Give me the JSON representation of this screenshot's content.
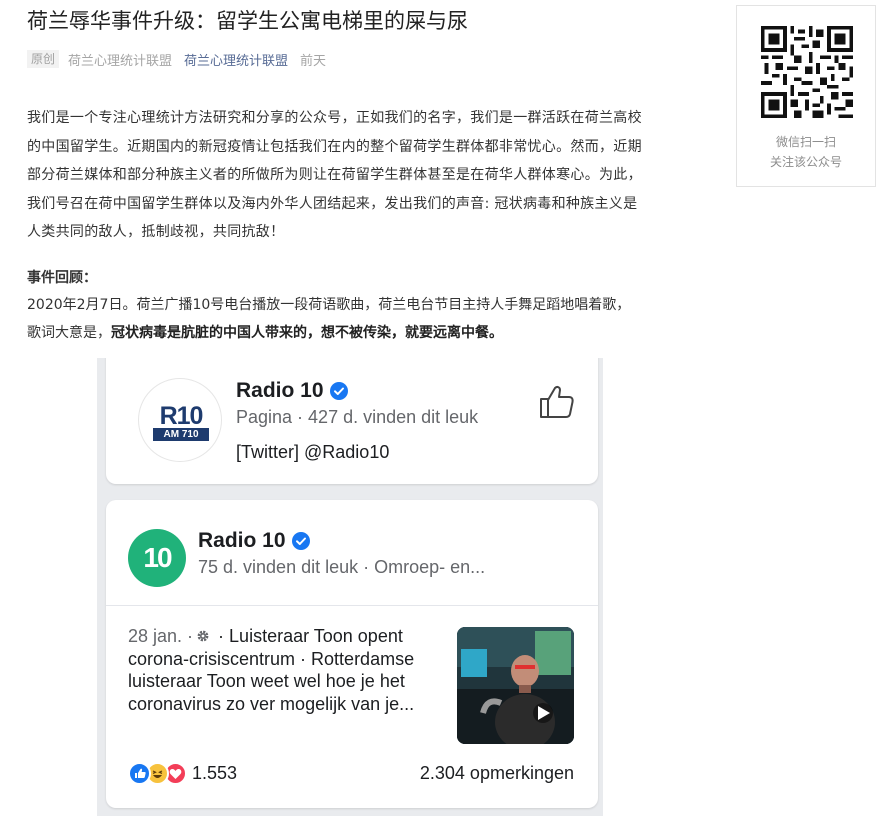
{
  "article": {
    "title": "荷兰辱华事件升级：留学生公寓电梯里的屎与尿",
    "meta": {
      "badge": "原创",
      "author": "荷兰心理统计联盟",
      "account": "荷兰心理统计联盟",
      "date": "前天"
    },
    "intro_lines": [
      "我们是一个专注心理统计方法研究和分享的公众号，正如我们的名字，我们是一群活跃在荷兰高校",
      "的中国留学生。近期国内的新冠疫情让包括我们在内的整个留荷学生群体都非常忧心。然而，近期",
      "部分荷兰媒体和部分种族主义者的所做所为则让在荷留学生群体甚至是在荷华人群体寒心。为此，",
      "我们号召在荷中国留学生群体以及海内外华人团结起来，发出我们的声音: 冠状病毒和种族主义是",
      "人类共同的敌人，抵制歧视，共同抗敌！"
    ],
    "recap_title": "事件回顾：",
    "recap_line1": "2020年2月7日。荷兰广播10号电台播放一段荷语歌曲，荷兰电台节目主持人手舞足蹈地唱着歌，",
    "recap_line2_prefix": "歌词大意是，",
    "recap_line2_bold": "冠状病毒是肮脏的中国人带来的，想不被传染，就要远离中餐。"
  },
  "qr": {
    "caption_line1": "微信扫一扫",
    "caption_line2": "关注该公众号"
  },
  "screenshot": {
    "card1": {
      "logo_text": "R10",
      "logo_sub": "AM 710",
      "name": "Radio 10",
      "subtitle": "Pagina · 427 d. vinden dit leuk",
      "twitter": "[Twitter] @Radio10"
    },
    "card2": {
      "logo_text": "10",
      "name": "Radio 10",
      "subtitle": "75 d. vinden dit leuk · Omroep- en...",
      "post_date": "28 jan. ·",
      "post_text": " · Luisteraar Toon opent corona-crisiscentrum · Rotterdamse luisteraar Toon weet wel hoe je het coronavirus zo ver mogelijk van je...",
      "reaction_count": "1.553",
      "comments": "2.304 opmerkingen"
    },
    "colors": {
      "verified": "#1877f2",
      "radio10_green": "#20b27a",
      "r10_navy": "#1e3b6e",
      "link_blue": "#576b95"
    }
  }
}
